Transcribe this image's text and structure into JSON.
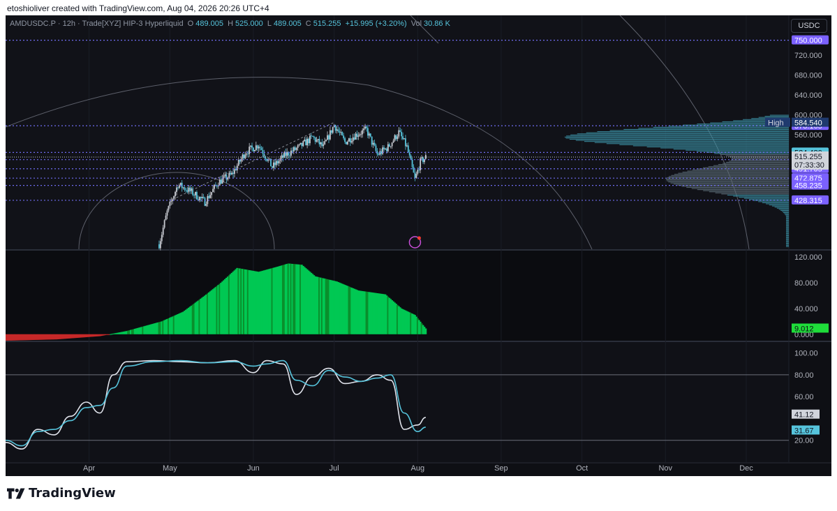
{
  "header": {
    "caption": "etoshioliver created with TradingView.com, Aug 04, 2026 20:26 UTC+4"
  },
  "legend": {
    "symbol": "AMDUSDC.P · 12h · Trade[XYZ] HIP-3 Hyperliquid",
    "o_label": "O",
    "o_value": "489.005",
    "h_label": "H",
    "h_value": "525.000",
    "l_label": "L",
    "l_value": "489.005",
    "c_label": "C",
    "c_value": "515.255",
    "change": "+15.995 (+3.20%)",
    "vol_label": "Vol",
    "vol_value": "30.86 K"
  },
  "currency_button": "USDC",
  "brand": "TradingView",
  "colors": {
    "background": "#0e0f14",
    "candle": "#c7cad1",
    "candle_alt": "#56c4dc",
    "level_line": "#6f6cf0",
    "label_purple": "#7b61ff",
    "label_cyan": "#56c4dc",
    "oscillator_green": "#00c853",
    "oscillator_red": "#c62828",
    "stoch_k": "#e0e3eb",
    "stoch_d": "#56c4dc"
  },
  "chart_data": [
    {
      "type": "candlestick",
      "name": "AMDUSDC.P 12h",
      "ylim": [
        330,
        800
      ],
      "y_ticks": [
        "720.000",
        "680.000",
        "640.000",
        "600.000",
        "560.000"
      ],
      "x_ticks": [
        "Apr",
        "May",
        "Jun",
        "Jul",
        "Aug",
        "Sep",
        "Oct",
        "Nov",
        "Dec"
      ],
      "price_path": [
        {
          "x": "2026-04-27",
          "y": 340
        },
        {
          "x": "2026-04-30",
          "y": 405
        },
        {
          "x": "2026-05-04",
          "y": 460
        },
        {
          "x": "2026-05-09",
          "y": 445
        },
        {
          "x": "2026-05-14",
          "y": 425
        },
        {
          "x": "2026-05-19",
          "y": 465
        },
        {
          "x": "2026-05-24",
          "y": 480
        },
        {
          "x": "2026-05-29",
          "y": 525
        },
        {
          "x": "2026-06-03",
          "y": 540
        },
        {
          "x": "2026-06-08",
          "y": 495
        },
        {
          "x": "2026-06-13",
          "y": 520
        },
        {
          "x": "2026-06-18",
          "y": 535
        },
        {
          "x": "2026-06-23",
          "y": 555
        },
        {
          "x": "2026-06-27",
          "y": 535
        },
        {
          "x": "2026-07-01",
          "y": 580
        },
        {
          "x": "2026-07-05",
          "y": 545
        },
        {
          "x": "2026-07-09",
          "y": 560
        },
        {
          "x": "2026-07-13",
          "y": 570
        },
        {
          "x": "2026-07-17",
          "y": 520
        },
        {
          "x": "2026-07-21",
          "y": 535
        },
        {
          "x": "2026-07-25",
          "y": 565
        },
        {
          "x": "2026-07-28",
          "y": 535
        },
        {
          "x": "2026-07-31",
          "y": 470
        },
        {
          "x": "2026-08-02",
          "y": 505
        },
        {
          "x": "2026-08-04",
          "y": 515
        }
      ],
      "levels": [
        {
          "label": "750.000",
          "value": 750,
          "color": "purple"
        },
        {
          "label": "578.165",
          "value": 578.165,
          "color": "purple"
        },
        {
          "label": "524.480",
          "value": 524.48,
          "color": "cyan"
        },
        {
          "label": "510.050",
          "value": 510.05,
          "color": "purple"
        },
        {
          "label": "491.705",
          "value": 491.705,
          "color": "purple"
        },
        {
          "label": "472.875",
          "value": 472.875,
          "color": "purple"
        },
        {
          "label": "458.235",
          "value": 458.235,
          "color": "purple"
        },
        {
          "label": "428.315",
          "value": 428.315,
          "color": "purple"
        }
      ],
      "high_label": "High",
      "high_value": "584.540",
      "last_price": "515.255",
      "countdown": "07:33:30",
      "volume_profile": "right-side horizontal histogram, peak near 560"
    },
    {
      "type": "bar",
      "name": "momentum oscillator",
      "ylim": [
        -10,
        130
      ],
      "y_ticks": [
        "120.000",
        "80.000",
        "40.000",
        "0.000"
      ],
      "last_value": "9.012",
      "envelope": [
        {
          "x": "2026-03-01",
          "y": -10
        },
        {
          "x": "2026-03-20",
          "y": -8
        },
        {
          "x": "2026-04-05",
          "y": -3
        },
        {
          "x": "2026-04-15",
          "y": 5
        },
        {
          "x": "2026-04-28",
          "y": 20
        },
        {
          "x": "2026-05-06",
          "y": 35
        },
        {
          "x": "2026-05-14",
          "y": 60
        },
        {
          "x": "2026-05-20",
          "y": 80
        },
        {
          "x": "2026-05-26",
          "y": 103
        },
        {
          "x": "2026-06-03",
          "y": 97
        },
        {
          "x": "2026-06-10",
          "y": 105
        },
        {
          "x": "2026-06-14",
          "y": 110
        },
        {
          "x": "2026-06-19",
          "y": 108
        },
        {
          "x": "2026-06-24",
          "y": 90
        },
        {
          "x": "2026-07-02",
          "y": 82
        },
        {
          "x": "2026-07-10",
          "y": 68
        },
        {
          "x": "2026-07-20",
          "y": 62
        },
        {
          "x": "2026-07-26",
          "y": 40
        },
        {
          "x": "2026-07-31",
          "y": 30
        },
        {
          "x": "2026-08-04",
          "y": 9
        }
      ]
    },
    {
      "type": "line",
      "name": "stochastic",
      "ylim": [
        0,
        110
      ],
      "y_ticks": [
        "100.00",
        "80.00",
        "60.00",
        "20.00"
      ],
      "bands": [
        80,
        20
      ],
      "last_values": [
        "41.12",
        "31.67"
      ],
      "series": [
        {
          "values": [
            {
              "x": "2026-03-01",
              "y": 18
            },
            {
              "x": "2026-03-07",
              "y": 12
            },
            {
              "x": "2026-03-13",
              "y": 30
            },
            {
              "x": "2026-03-19",
              "y": 25
            },
            {
              "x": "2026-03-25",
              "y": 42
            },
            {
              "x": "2026-03-31",
              "y": 55
            },
            {
              "x": "2026-04-05",
              "y": 45
            },
            {
              "x": "2026-04-10",
              "y": 80
            },
            {
              "x": "2026-04-15",
              "y": 92
            },
            {
              "x": "2026-04-25",
              "y": 93
            },
            {
              "x": "2026-05-05",
              "y": 92
            },
            {
              "x": "2026-05-15",
              "y": 91
            },
            {
              "x": "2026-05-25",
              "y": 93
            },
            {
              "x": "2026-06-01",
              "y": 82
            },
            {
              "x": "2026-06-06",
              "y": 93
            },
            {
              "x": "2026-06-12",
              "y": 90
            },
            {
              "x": "2026-06-17",
              "y": 62
            },
            {
              "x": "2026-06-23",
              "y": 78
            },
            {
              "x": "2026-06-29",
              "y": 86
            },
            {
              "x": "2026-07-05",
              "y": 72
            },
            {
              "x": "2026-07-11",
              "y": 74
            },
            {
              "x": "2026-07-17",
              "y": 80
            },
            {
              "x": "2026-07-22",
              "y": 75
            },
            {
              "x": "2026-07-27",
              "y": 30
            },
            {
              "x": "2026-08-01",
              "y": 34
            },
            {
              "x": "2026-08-04",
              "y": 41
            }
          ]
        },
        {
          "values": [
            {
              "x": "2026-03-01",
              "y": 20
            },
            {
              "x": "2026-03-07",
              "y": 15
            },
            {
              "x": "2026-03-13",
              "y": 28
            },
            {
              "x": "2026-03-19",
              "y": 30
            },
            {
              "x": "2026-03-25",
              "y": 38
            },
            {
              "x": "2026-03-31",
              "y": 50
            },
            {
              "x": "2026-04-05",
              "y": 52
            },
            {
              "x": "2026-04-10",
              "y": 68
            },
            {
              "x": "2026-04-15",
              "y": 88
            },
            {
              "x": "2026-04-25",
              "y": 92
            },
            {
              "x": "2026-05-05",
              "y": 93
            },
            {
              "x": "2026-05-15",
              "y": 91
            },
            {
              "x": "2026-05-25",
              "y": 92
            },
            {
              "x": "2026-06-01",
              "y": 88
            },
            {
              "x": "2026-06-06",
              "y": 90
            },
            {
              "x": "2026-06-12",
              "y": 93
            },
            {
              "x": "2026-06-17",
              "y": 75
            },
            {
              "x": "2026-06-23",
              "y": 70
            },
            {
              "x": "2026-06-29",
              "y": 84
            },
            {
              "x": "2026-07-05",
              "y": 78
            },
            {
              "x": "2026-07-11",
              "y": 74
            },
            {
              "x": "2026-07-17",
              "y": 77
            },
            {
              "x": "2026-07-22",
              "y": 80
            },
            {
              "x": "2026-07-27",
              "y": 45
            },
            {
              "x": "2026-08-01",
              "y": 28
            },
            {
              "x": "2026-08-04",
              "y": 32
            }
          ]
        }
      ]
    }
  ]
}
